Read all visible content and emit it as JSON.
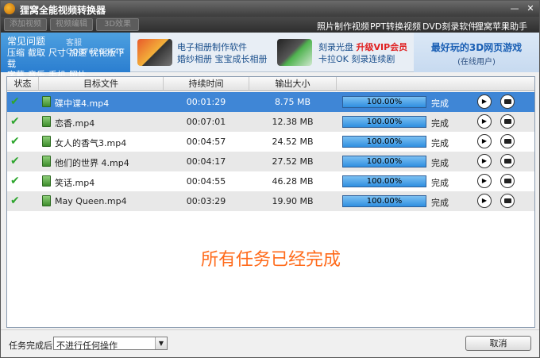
{
  "window": {
    "title": "狸窝全能视频转换器",
    "minimize_icon": "minimize-icon",
    "close_icon": "close-icon"
  },
  "toolbar": {
    "buttons": [
      "添加视频",
      "视频编辑",
      "3D效果"
    ],
    "nav": [
      "照片制作视频",
      "PPT转换视频",
      "DVD刻录软件",
      "狸窝苹果助手"
    ]
  },
  "banner": {
    "faq_title": "常见问题",
    "qq": "客服QQ876292449",
    "faq_links": [
      "压缩",
      "截取",
      "尺寸",
      "加速",
      "优化版下载",
      "字幕",
      "音乐",
      "手机",
      "照片"
    ],
    "promo1": {
      "line1": "电子相册制作软件",
      "line2": "婚纱相册 宝宝成长相册"
    },
    "promo2": {
      "line1": "刻录光盘",
      "line1_hot": "升级VIP会员",
      "line2": "卡拉OK 刻录连续剧"
    },
    "game": {
      "title": "最好玩的3D网页游戏",
      "sub": "(在线用户)"
    }
  },
  "table": {
    "headers": [
      "状态",
      "目标文件",
      "持续时间",
      "输出大小"
    ],
    "rows": [
      {
        "file": "碟中谍4.mp4",
        "duration": "00:01:29",
        "size": "8.75 MB",
        "progress": "100.00%",
        "status": "完成"
      },
      {
        "file": "恋香.mp4",
        "duration": "00:07:01",
        "size": "12.38 MB",
        "progress": "100.00%",
        "status": "完成"
      },
      {
        "file": "女人的香气3.mp4",
        "duration": "00:04:57",
        "size": "24.52 MB",
        "progress": "100.00%",
        "status": "完成"
      },
      {
        "file": "他们的世界 4.mp4",
        "duration": "00:04:17",
        "size": "27.52 MB",
        "progress": "100.00%",
        "status": "完成"
      },
      {
        "file": "笑话.mp4",
        "duration": "00:04:55",
        "size": "46.28 MB",
        "progress": "100.00%",
        "status": "完成"
      },
      {
        "file": "May Queen.mp4",
        "duration": "00:03:29",
        "size": "19.90 MB",
        "progress": "100.00%",
        "status": "完成"
      }
    ],
    "done_message": "所有任务已经完成"
  },
  "footer": {
    "after_label": "任务完成后:",
    "after_value": "不进行任何操作",
    "cancel": "取消"
  }
}
